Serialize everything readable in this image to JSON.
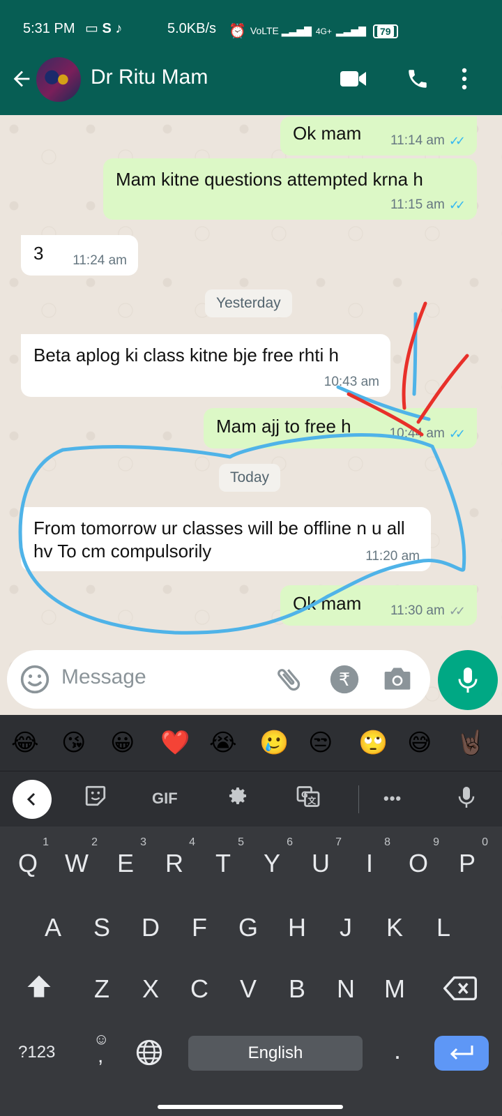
{
  "status_bar": {
    "time": "5:31 PM",
    "network_speed": "5.0KB/s",
    "network_type": "4G+",
    "battery": "79"
  },
  "header": {
    "contact_name": "Dr Ritu Mam",
    "background_color": "#075e54"
  },
  "messages": [
    {
      "direction": "out",
      "text": "Ok mam",
      "time": "11:14 am",
      "status": "read"
    },
    {
      "direction": "out",
      "text": "Mam kitne questions attempted krna h",
      "time": "11:15 am",
      "status": "read"
    },
    {
      "direction": "in",
      "text": "3",
      "time": "11:24 am"
    },
    {
      "direction": "in",
      "text": "Beta aplog ki class kitne bje free rhti h",
      "time": "10:43 am"
    },
    {
      "direction": "out",
      "text": "Mam ajj to free h",
      "time": "10:44 am",
      "status": "read"
    },
    {
      "direction": "in",
      "text": "From tomorrow ur classes will be offline n u all hv To cm compulsorily",
      "time": "11:20 am"
    },
    {
      "direction": "out",
      "text": "Ok mam",
      "time": "11:30 am",
      "status": "delivered"
    }
  ],
  "date_chips": {
    "yesterday": "Yesterday",
    "today": "Today"
  },
  "composer": {
    "placeholder": "Message"
  },
  "keyboard": {
    "emoji_suggestions": [
      "😂",
      "😘",
      "😀",
      "❤️",
      "😭",
      "🥲",
      "😒",
      "🙄",
      "😅",
      "🤘🏿"
    ],
    "toolbar_gif": "GIF",
    "toolbar_more": "•••",
    "row1": [
      "Q",
      "W",
      "E",
      "R",
      "T",
      "Y",
      "U",
      "I",
      "O",
      "P"
    ],
    "row1_hints": [
      "1",
      "2",
      "3",
      "4",
      "5",
      "6",
      "7",
      "8",
      "9",
      "0"
    ],
    "row2": [
      "A",
      "S",
      "D",
      "F",
      "G",
      "H",
      "J",
      "K",
      "L"
    ],
    "row3": [
      "Z",
      "X",
      "C",
      "V",
      "B",
      "N",
      "M"
    ],
    "symbols_key": "?123",
    "comma_key": ",",
    "period_key": ".",
    "space_label": "English"
  },
  "colors": {
    "outgoing_bubble": "#dcf8c6",
    "read_ticks": "#34b7f1",
    "mic_button": "#00a884",
    "annotation_blue": "#4fb3e8",
    "annotation_red": "#e8302a"
  }
}
